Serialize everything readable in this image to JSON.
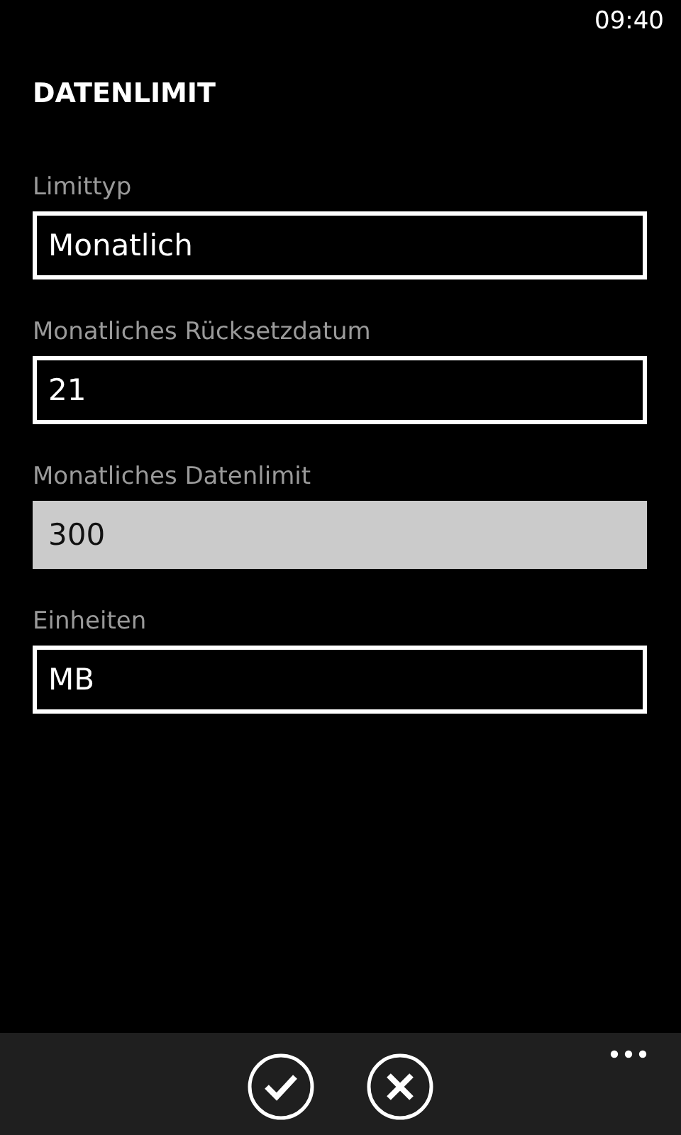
{
  "status_bar": {
    "time": "09:40"
  },
  "title": "DATENLIMIT",
  "fields": [
    {
      "label": "Limittyp",
      "value": "Monatlich",
      "focused": false
    },
    {
      "label": "Monatliches Rücksetzdatum",
      "value": "21",
      "focused": false
    },
    {
      "label": "Monatliches Datenlimit",
      "value": "300",
      "focused": true
    },
    {
      "label": "Einheiten",
      "value": "MB",
      "focused": false
    }
  ],
  "app_bar": {
    "buttons": [
      {
        "kind": "check"
      },
      {
        "kind": "cancel"
      }
    ]
  }
}
